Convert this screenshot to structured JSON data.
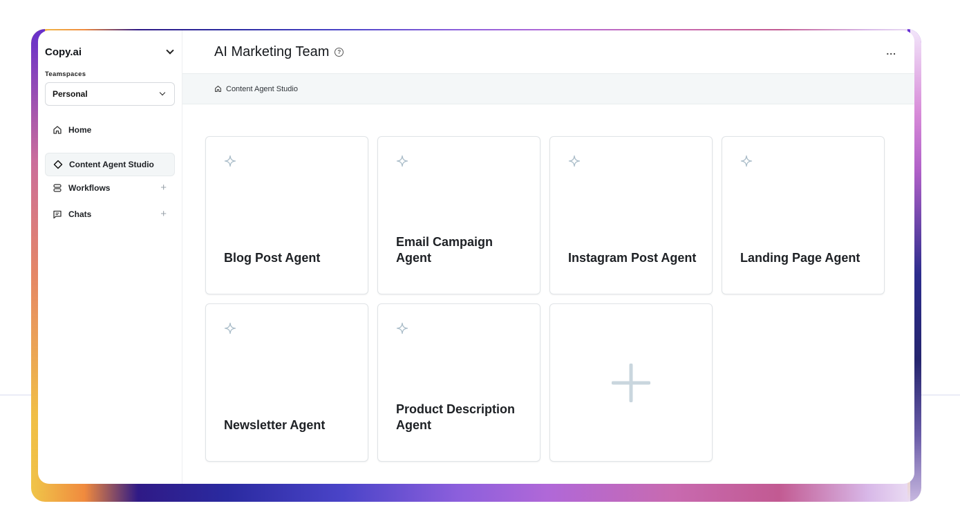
{
  "sidebar": {
    "brand": "Copy.ai",
    "teamspaces_label": "Teamspaces",
    "teamspace_selected": "Personal",
    "items": [
      {
        "label": "Home",
        "icon": "home-icon"
      },
      {
        "label": "Content Agent Studio",
        "icon": "diamond-icon",
        "active": true
      },
      {
        "label": "Workflows",
        "icon": "workflow-icon",
        "add": "+"
      },
      {
        "label": "Chats",
        "icon": "chat-icon",
        "add": "+"
      }
    ]
  },
  "header": {
    "title": "AI Marketing Team",
    "help": "?",
    "more": "..."
  },
  "breadcrumb": {
    "label": "Content Agent Studio"
  },
  "agents": [
    {
      "name": "Blog Post Agent"
    },
    {
      "name": "Email Campaign Agent"
    },
    {
      "name": "Instagram Post Agent"
    },
    {
      "name": "Landing Page Agent"
    },
    {
      "name": "Newsletter Agent"
    },
    {
      "name": "Product Description Agent"
    }
  ],
  "colors": {
    "spark": "#a9bcc8",
    "plus": "#c9d6de"
  }
}
